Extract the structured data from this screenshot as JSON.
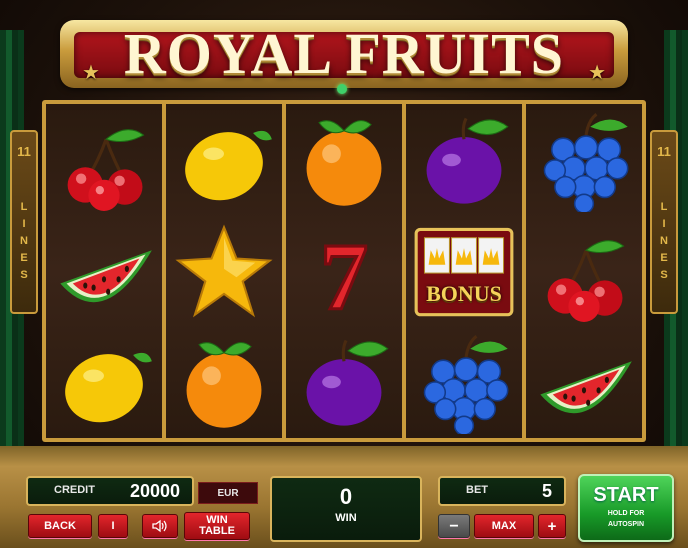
{
  "title": "ROYAL FRUITS",
  "lines_left": {
    "count": "11",
    "label": "LINES"
  },
  "lines_right": {
    "count": "11",
    "label": "LINES"
  },
  "reels": [
    [
      "cherries",
      "watermelon",
      "lemon"
    ],
    [
      "lemon",
      "star",
      "orange"
    ],
    [
      "orange",
      "seven",
      "plum"
    ],
    [
      "plum",
      "bonus",
      "grapes"
    ],
    [
      "grapes",
      "cherries",
      "watermelon"
    ]
  ],
  "bonus_label": "BONUS",
  "panel": {
    "credit_label": "CREDIT",
    "credit_value": "20000",
    "currency": "EUR",
    "win_value": "0",
    "win_label": "WIN",
    "bet_label": "BET",
    "bet_value": "5",
    "back_label": "BACK",
    "info_label": "I",
    "sound_icon": "speaker-icon",
    "wintable_label_1": "WIN",
    "wintable_label_2": "TABLE",
    "minus_label": "−",
    "max_label": "MAX",
    "plus_label": "+",
    "start_label": "START",
    "start_sub_1": "HOLD FOR",
    "start_sub_2": "AUTOSPIN"
  },
  "colors": {
    "gold": "#c99b3c",
    "red": "#e3262c",
    "green": "#189a28",
    "panel_green": "#0f2a12"
  }
}
